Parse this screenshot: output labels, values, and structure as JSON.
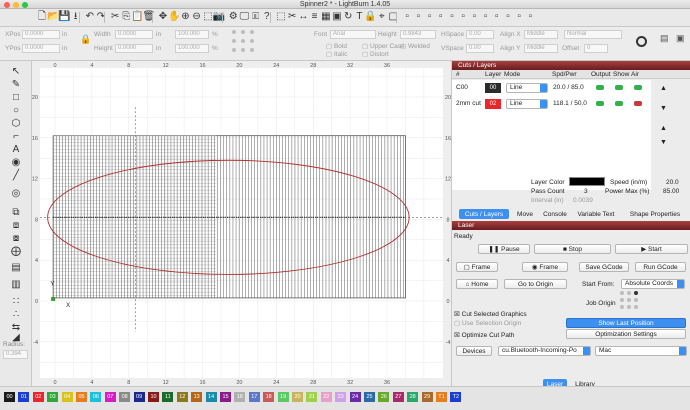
{
  "window": {
    "title": "Spinner2 * - LightBurn 1.4.05"
  },
  "toolbar": {
    "icons": [
      "new-file-icon",
      "open-file-icon",
      "save-file-icon",
      "import-icon",
      "undo-icon",
      "redo-icon",
      "cut-icon",
      "copy-icon",
      "paste-icon",
      "delete-icon",
      "move-icon",
      "pan-icon",
      "zoom-in-icon",
      "zoom-out-icon",
      "zoom-frame-icon",
      "camera-icon",
      "settings-icon",
      "monitor-icon",
      "notes-icon",
      "help-icon",
      "trace-icon",
      "scissors-icon",
      "measure-icon",
      "align-icon",
      "grid-icon",
      "array-icon",
      "rotary-icon",
      "text-icon",
      "lock-icon",
      "position-icon",
      "frame-icon",
      "tools-icon",
      "tools2-icon",
      "tools3-icon",
      "tools4-icon",
      "tools5-icon",
      "tools6-icon",
      "tools7-icon",
      "tools8-icon",
      "tools9-icon",
      "tools10-icon",
      "tools11-icon",
      "tools12-icon"
    ]
  },
  "props": {
    "xpos_label": "XPos",
    "xpos_value": "0.0000",
    "ypos_label": "YPos",
    "ypos_value": "0.0000",
    "x_unit": "in",
    "y_unit": "in",
    "width_label": "Width",
    "width_value": "0.0000",
    "height_label": "Height",
    "height_value": "0.0000",
    "w_unit": "in",
    "h_unit": "in",
    "scale_w": "100.000",
    "scale_h": "100.000",
    "pct": "%",
    "font_label": "Font",
    "font_value": "Arial",
    "fheight_label": "Height",
    "fheight_value": "0.9843",
    "hspace_label": "HSpace",
    "hspace_value": "0.00",
    "vspace_label": "VSpace",
    "vspace_value": "0.00",
    "alignx_label": "Align X",
    "alignx_value": "Middle",
    "aligny_label": "Align Y",
    "aligny_value": "Middle",
    "normal_value": "Normal",
    "offset_label": "Offset",
    "offset_value": "0",
    "bold": "Bold",
    "italic": "Italic",
    "upper": "Upper Case",
    "welded": "Welded",
    "distort": "Distort"
  },
  "canvas": {
    "x_ticks": [
      "0",
      "4",
      "8",
      "12",
      "16",
      "20",
      "24",
      "28",
      "32",
      "36"
    ],
    "x_ticks_bottom": [
      "-4",
      "0",
      "4",
      "8",
      "12",
      "16",
      "20",
      "24",
      "28",
      "32",
      "36"
    ],
    "y_ticks": [
      "20",
      "16",
      "12",
      "8",
      "4",
      "0",
      "-4"
    ],
    "origin_x": "X",
    "origin_y": "Y"
  },
  "layers": {
    "title": "Cuts / Layers",
    "headers": [
      "#",
      "Layer",
      "Mode",
      "Spd/Pwr",
      "Output",
      "Show",
      "Air"
    ],
    "rows": [
      {
        "name": "C00",
        "num": "00",
        "color": "#2b2b2b",
        "mode": "Line",
        "spdpwr": "20.0 / 85.0"
      },
      {
        "name": "2mm cut",
        "num": "02",
        "color": "#e8262b",
        "mode": "Line",
        "spdpwr": "118.1 / 50.0"
      }
    ],
    "layer_color_label": "Layer Color",
    "speed_label": "Speed (in/m)",
    "speed_value": "20.0",
    "pass_label": "Pass Count",
    "pass_value": "3",
    "power_label": "Power Max (%)",
    "power_value": "85.00",
    "interval_label": "Interval (in)",
    "interval_value": "0.0039",
    "tabs": [
      "Cuts / Layers",
      "Move",
      "Console",
      "Variable Text",
      "Shape Properties"
    ]
  },
  "laser": {
    "title": "Laser",
    "status": "Ready",
    "pause": "Pause",
    "stop": "Stop",
    "start": "Start",
    "frame1": "Frame",
    "frame2": "Frame",
    "save_gcode": "Save GCode",
    "run_gcode": "Run GCode",
    "home": "Home",
    "go_origin": "Go to Origin",
    "start_from_label": "Start From:",
    "start_from_value": "Absolute Coords",
    "job_origin_label": "Job Origin",
    "cut_selected": "Cut Selected Graphics",
    "use_selection_origin": "Use Selection Origin",
    "optimize_cut": "Optimize Cut Path",
    "show_last_position": "Show Last Position",
    "optimization_settings": "Optimization Settings",
    "devices": "Devices",
    "port_value": "cu.Bluetooth-Incoming-Po",
    "device_value": "Mac",
    "bottom_tabs": [
      "Laser",
      "Library"
    ]
  },
  "toolbox": {
    "radius_label": "Radius:",
    "radius_value": "0.394"
  },
  "palette": {
    "swatches": [
      {
        "label": "00",
        "color": "#1a1a1a"
      },
      {
        "label": "01",
        "color": "#1a3fd0"
      },
      {
        "label": "02",
        "color": "#e8262b"
      },
      {
        "label": "03",
        "color": "#2fa83a"
      },
      {
        "label": "04",
        "color": "#d8c21c"
      },
      {
        "label": "05",
        "color": "#e87d1c"
      },
      {
        "label": "06",
        "color": "#1cc0d8"
      },
      {
        "label": "07",
        "color": "#d81cc8"
      },
      {
        "label": "08",
        "color": "#8a8a8a"
      },
      {
        "label": "09",
        "color": "#1a2a8a"
      },
      {
        "label": "10",
        "color": "#8a1a1a"
      },
      {
        "label": "11",
        "color": "#1a6a2a"
      },
      {
        "label": "12",
        "color": "#8a7a1a"
      },
      {
        "label": "13",
        "color": "#b4661a"
      },
      {
        "label": "14",
        "color": "#1a8aa8"
      },
      {
        "label": "15",
        "color": "#8a1a8a"
      },
      {
        "label": "16",
        "color": "#b0b0b0"
      },
      {
        "label": "17",
        "color": "#5a78c8"
      },
      {
        "label": "18",
        "color": "#c85a5a"
      },
      {
        "label": "19",
        "color": "#5ac864"
      },
      {
        "label": "20",
        "color": "#c8b45a"
      },
      {
        "label": "21",
        "color": "#a0d04a"
      },
      {
        "label": "22",
        "color": "#e8a0c8"
      },
      {
        "label": "23",
        "color": "#d0a0e8"
      },
      {
        "label": "24",
        "color": "#6a2aa8"
      },
      {
        "label": "25",
        "color": "#2a6aa8"
      },
      {
        "label": "26",
        "color": "#6aa82a"
      },
      {
        "label": "27",
        "color": "#a82a6a"
      },
      {
        "label": "28",
        "color": "#2aa86a"
      },
      {
        "label": "29",
        "color": "#a86a2a"
      },
      {
        "label": "T1",
        "color": "#e87d1c"
      },
      {
        "label": "T2",
        "color": "#1a3fd0"
      }
    ]
  }
}
